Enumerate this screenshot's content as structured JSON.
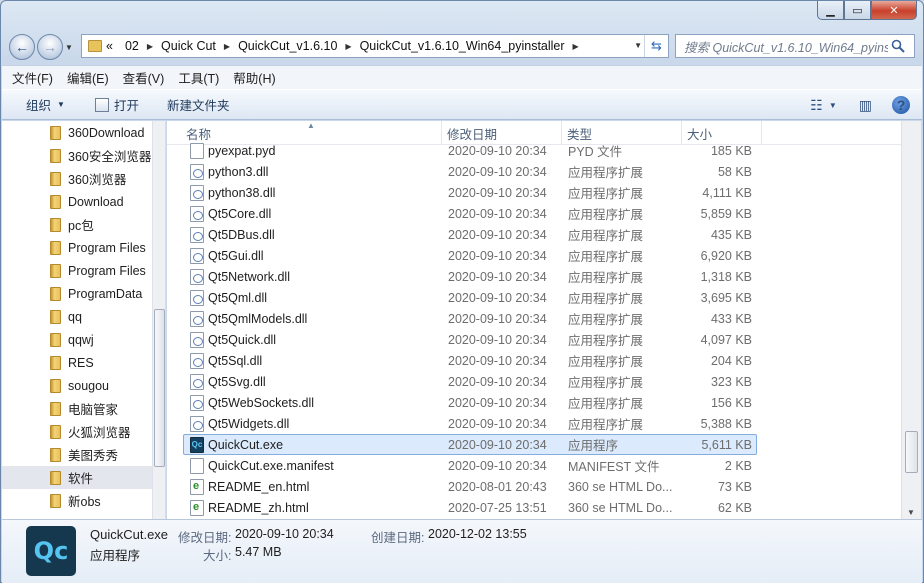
{
  "window": {
    "min": "▁",
    "max": "▭",
    "close": "✕"
  },
  "nav": {
    "back": "←",
    "fwd": "→"
  },
  "address": {
    "prefix": "«",
    "crumbs": [
      "02",
      "Quick Cut",
      "QuickCut_v1.6.10",
      "QuickCut_v1.6.10_Win64_pyinstaller"
    ]
  },
  "search": {
    "placeholder": "搜索 QuickCut_v1.6.10_Win64_pyinstaller"
  },
  "menu": [
    "文件(F)",
    "编辑(E)",
    "查看(V)",
    "工具(T)",
    "帮助(H)"
  ],
  "commands": {
    "organize": "组织",
    "open": "打开",
    "new_folder": "新建文件夹"
  },
  "navpane": {
    "items": [
      "360Download",
      "360安全浏览器",
      "360浏览器",
      "Download",
      "pc包",
      "Program Files",
      "Program Files",
      "ProgramData",
      "qq",
      "qqwj",
      "RES",
      "sougou",
      "电脑管家",
      "火狐浏览器",
      "美图秀秀",
      "软件",
      "新obs"
    ],
    "selected_index": 15
  },
  "columns": {
    "name": "名称",
    "date": "修改日期",
    "type": "类型",
    "size": "大小"
  },
  "files": [
    {
      "name": "pyexpat.pyd",
      "date": "2020-09-10 20:34",
      "type": "PYD 文件",
      "size": "185 KB",
      "icon": "file"
    },
    {
      "name": "python3.dll",
      "date": "2020-09-10 20:34",
      "type": "应用程序扩展",
      "size": "58 KB",
      "icon": "dll"
    },
    {
      "name": "python38.dll",
      "date": "2020-09-10 20:34",
      "type": "应用程序扩展",
      "size": "4,111 KB",
      "icon": "dll"
    },
    {
      "name": "Qt5Core.dll",
      "date": "2020-09-10 20:34",
      "type": "应用程序扩展",
      "size": "5,859 KB",
      "icon": "dll"
    },
    {
      "name": "Qt5DBus.dll",
      "date": "2020-09-10 20:34",
      "type": "应用程序扩展",
      "size": "435 KB",
      "icon": "dll"
    },
    {
      "name": "Qt5Gui.dll",
      "date": "2020-09-10 20:34",
      "type": "应用程序扩展",
      "size": "6,920 KB",
      "icon": "dll"
    },
    {
      "name": "Qt5Network.dll",
      "date": "2020-09-10 20:34",
      "type": "应用程序扩展",
      "size": "1,318 KB",
      "icon": "dll"
    },
    {
      "name": "Qt5Qml.dll",
      "date": "2020-09-10 20:34",
      "type": "应用程序扩展",
      "size": "3,695 KB",
      "icon": "dll"
    },
    {
      "name": "Qt5QmlModels.dll",
      "date": "2020-09-10 20:34",
      "type": "应用程序扩展",
      "size": "433 KB",
      "icon": "dll"
    },
    {
      "name": "Qt5Quick.dll",
      "date": "2020-09-10 20:34",
      "type": "应用程序扩展",
      "size": "4,097 KB",
      "icon": "dll"
    },
    {
      "name": "Qt5Sql.dll",
      "date": "2020-09-10 20:34",
      "type": "应用程序扩展",
      "size": "204 KB",
      "icon": "dll"
    },
    {
      "name": "Qt5Svg.dll",
      "date": "2020-09-10 20:34",
      "type": "应用程序扩展",
      "size": "323 KB",
      "icon": "dll"
    },
    {
      "name": "Qt5WebSockets.dll",
      "date": "2020-09-10 20:34",
      "type": "应用程序扩展",
      "size": "156 KB",
      "icon": "dll"
    },
    {
      "name": "Qt5Widgets.dll",
      "date": "2020-09-10 20:34",
      "type": "应用程序扩展",
      "size": "5,388 KB",
      "icon": "dll"
    },
    {
      "name": "QuickCut.exe",
      "date": "2020-09-10 20:34",
      "type": "应用程序",
      "size": "5,611 KB",
      "icon": "exe",
      "selected": true
    },
    {
      "name": "QuickCut.exe.manifest",
      "date": "2020-09-10 20:34",
      "type": "MANIFEST 文件",
      "size": "2 KB",
      "icon": "file"
    },
    {
      "name": "README_en.html",
      "date": "2020-08-01 20:43",
      "type": "360 se HTML Do...",
      "size": "73 KB",
      "icon": "html"
    },
    {
      "name": "README_zh.html",
      "date": "2020-07-25 13:51",
      "type": "360 se HTML Do...",
      "size": "62 KB",
      "icon": "html"
    }
  ],
  "details": {
    "icon_text": "Qc",
    "name": "QuickCut.exe",
    "type": "应用程序",
    "modified_label": "修改日期:",
    "modified": "2020-09-10 20:34",
    "created_label": "创建日期:",
    "created": "2020-12-02 13:55",
    "size_label": "大小:",
    "size": "5.47 MB"
  },
  "colors": {
    "selection_bg": "#dbeafc",
    "selection_border": "#84acdd",
    "exe_icon_bg": "#16384f",
    "exe_icon_fg": "#55c5f0"
  }
}
